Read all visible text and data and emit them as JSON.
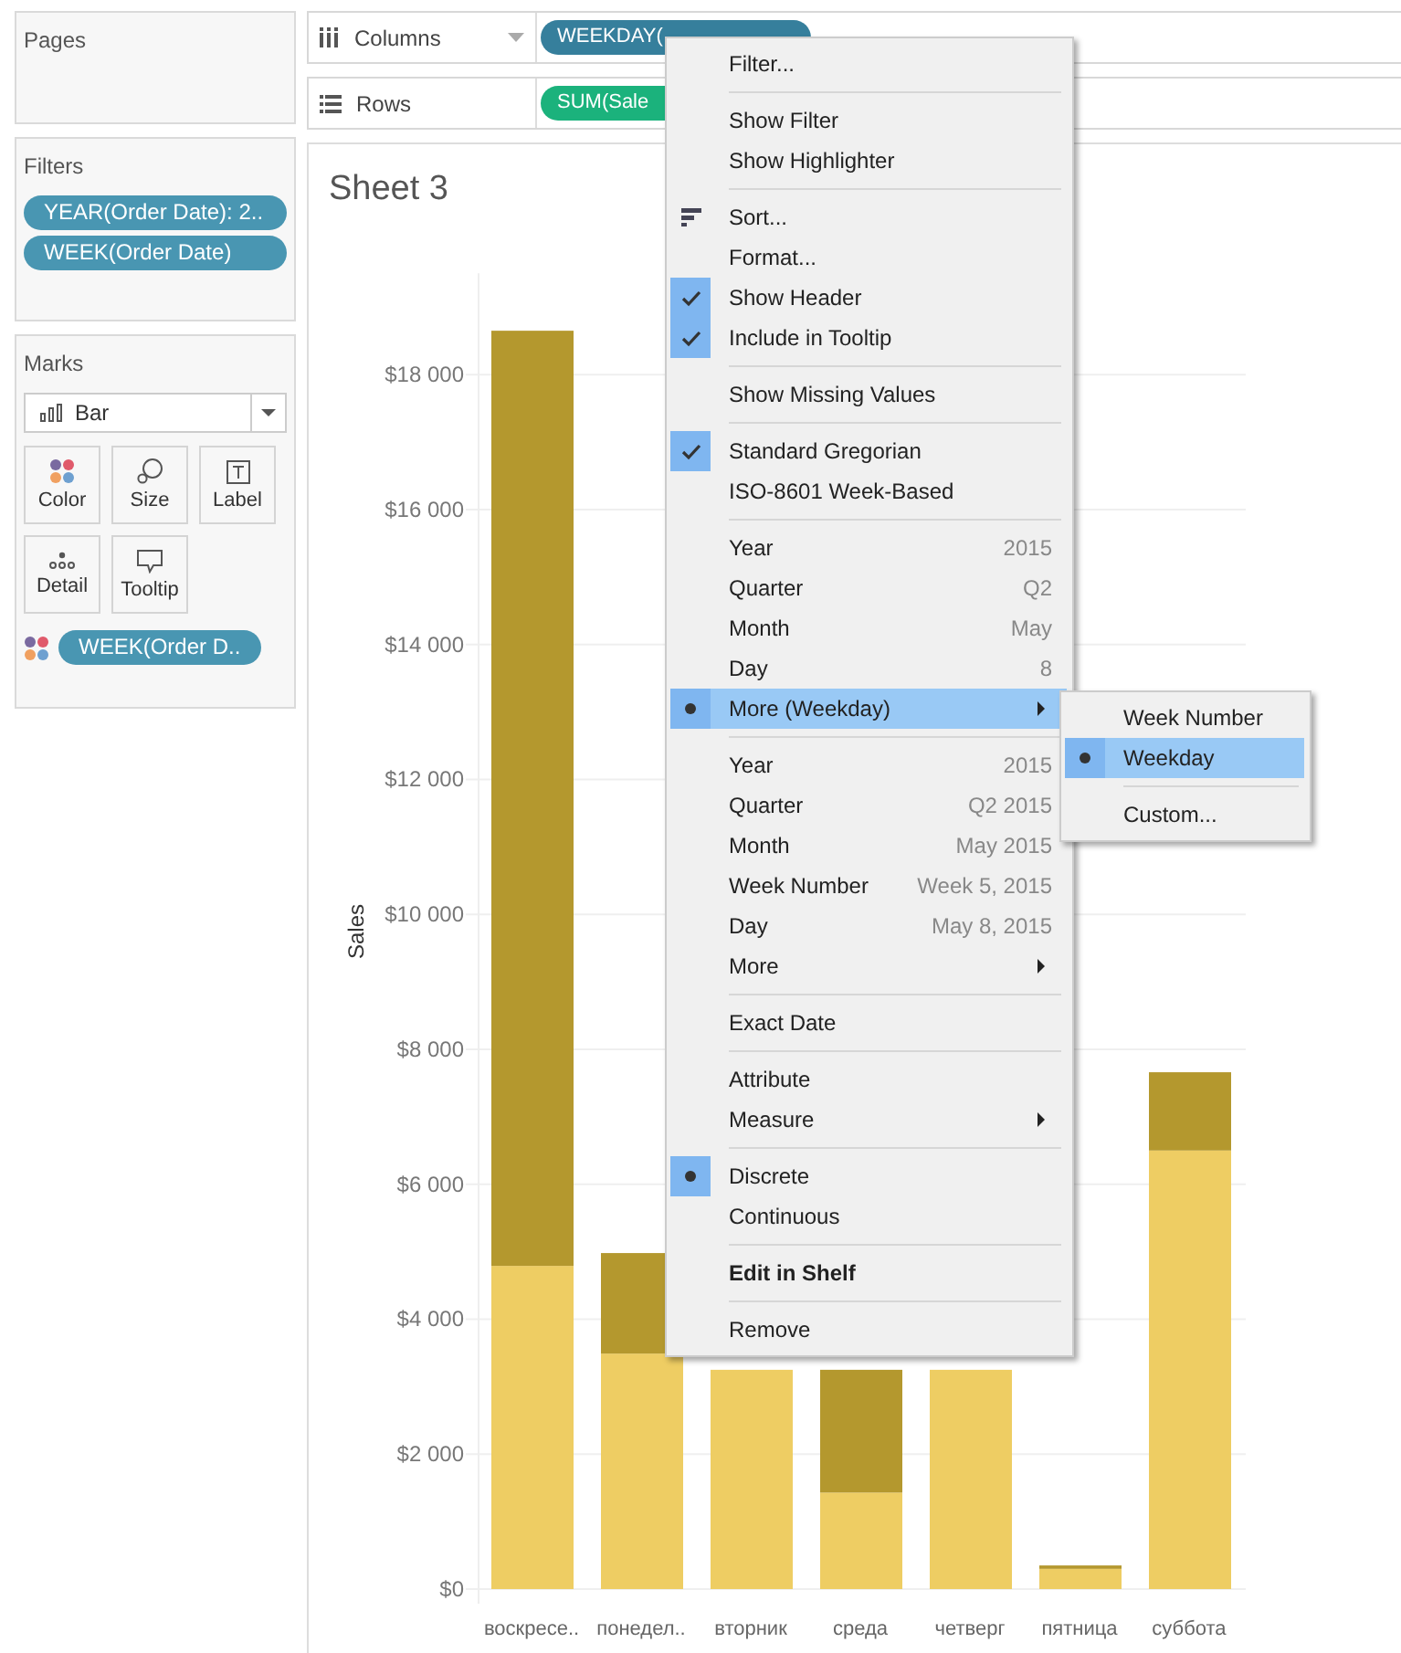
{
  "pages": {
    "title": "Pages"
  },
  "filters": {
    "title": "Filters",
    "pills": [
      "YEAR(Order Date): 2..",
      "WEEK(Order Date)"
    ]
  },
  "marks": {
    "title": "Marks",
    "mark_type": "Bar",
    "buttons": [
      {
        "label": "Color",
        "kind": "color"
      },
      {
        "label": "Size",
        "kind": "size"
      },
      {
        "label": "Label",
        "kind": "label"
      },
      {
        "label": "Detail",
        "kind": "detail"
      },
      {
        "label": "Tooltip",
        "kind": "tooltip"
      }
    ],
    "pill": "WEEK(Order D.."
  },
  "shelves": [
    {
      "label": "Columns",
      "kind": "columns",
      "pill": "WEEKDAY(",
      "measure": false
    },
    {
      "label": "Rows",
      "kind": "rows",
      "pill": "SUM(Sale",
      "measure": true
    }
  ],
  "sheet": {
    "title": "Sheet 3",
    "chart_data": {
      "type": "bar",
      "stacked": true,
      "ylabel": "Sales",
      "categories": [
        "воскресе..",
        "понедел..",
        "вторник",
        "среда",
        "четверг",
        "пятница",
        "суббота"
      ],
      "series": [
        {
          "color": "#eecd63",
          "values": [
            4790,
            3490,
            3250,
            1430,
            3250,
            300,
            6500
          ]
        },
        {
          "color": "#b4982e",
          "values": [
            13860,
            1490,
            null,
            1820,
            null,
            50,
            1160
          ]
        }
      ],
      "grid": true,
      "ylim": [
        0,
        19500
      ],
      "yticks": [
        {
          "value": 0,
          "label": "$0"
        },
        {
          "value": 2000,
          "label": "$2 000"
        },
        {
          "value": 4000,
          "label": "$4 000"
        },
        {
          "value": 6000,
          "label": "$6 000"
        },
        {
          "value": 8000,
          "label": "$8 000"
        },
        {
          "value": 10000,
          "label": "$10 000"
        },
        {
          "value": 12000,
          "label": "$12 000"
        },
        {
          "value": 14000,
          "label": "$14 000"
        },
        {
          "value": 16000,
          "label": "$16 000"
        },
        {
          "value": 18000,
          "label": "$18 000"
        }
      ]
    }
  },
  "context_menu": {
    "groups": [
      [
        {
          "label": "Filter...",
          "kind": "command",
          "checked": false,
          "selected": false,
          "submenu": false
        }
      ],
      [
        {
          "label": "Show Filter",
          "kind": "command",
          "checked": false,
          "selected": false,
          "submenu": false
        },
        {
          "label": "Show Highlighter",
          "kind": "command",
          "checked": false,
          "selected": false,
          "submenu": false
        }
      ],
      [
        {
          "label": "Sort...",
          "kind": "sort",
          "checked": false,
          "selected": false,
          "submenu": false
        },
        {
          "label": "Format...",
          "kind": "command",
          "checked": false,
          "selected": false,
          "submenu": false
        },
        {
          "label": "Show Header",
          "kind": "check",
          "checked": true,
          "selected": false,
          "submenu": false
        },
        {
          "label": "Include in Tooltip",
          "kind": "check",
          "checked": true,
          "selected": false,
          "submenu": false
        }
      ],
      [
        {
          "label": "Show Missing Values",
          "kind": "check",
          "checked": false,
          "selected": false,
          "submenu": false
        }
      ],
      [
        {
          "label": "Standard Gregorian",
          "kind": "check",
          "checked": true,
          "selected": false,
          "submenu": false
        },
        {
          "label": "ISO-8601 Week-Based",
          "kind": "check",
          "checked": false,
          "selected": false,
          "submenu": false
        }
      ],
      [
        {
          "label": "Year",
          "value": "2015",
          "kind": "radio",
          "checked": false,
          "selected": false,
          "submenu": false
        },
        {
          "label": "Quarter",
          "value": "Q2",
          "kind": "radio",
          "checked": false,
          "selected": false,
          "submenu": false
        },
        {
          "label": "Month",
          "value": "May",
          "kind": "radio",
          "checked": false,
          "selected": false,
          "submenu": false
        },
        {
          "label": "Day",
          "value": "8",
          "kind": "radio",
          "checked": false,
          "selected": false,
          "submenu": false
        },
        {
          "label": "More (Weekday)",
          "kind": "radio",
          "checked": true,
          "selected": true,
          "submenu": true
        }
      ],
      [
        {
          "label": "Year",
          "value": "2015",
          "kind": "radio",
          "checked": false,
          "selected": false,
          "submenu": false
        },
        {
          "label": "Quarter",
          "value": "Q2 2015",
          "kind": "radio",
          "checked": false,
          "selected": false,
          "submenu": false
        },
        {
          "label": "Month",
          "value": "May 2015",
          "kind": "radio",
          "checked": false,
          "selected": false,
          "submenu": false
        },
        {
          "label": "Week Number",
          "value": "Week 5, 2015",
          "kind": "radio",
          "checked": false,
          "selected": false,
          "submenu": false
        },
        {
          "label": "Day",
          "value": "May 8, 2015",
          "kind": "radio",
          "checked": false,
          "selected": false,
          "submenu": false
        },
        {
          "label": "More",
          "kind": "radio",
          "checked": false,
          "selected": false,
          "submenu": true
        }
      ],
      [
        {
          "label": "Exact Date",
          "kind": "radio",
          "checked": false,
          "selected": false,
          "submenu": false
        }
      ],
      [
        {
          "label": "Attribute",
          "kind": "radio",
          "checked": false,
          "selected": false,
          "submenu": false
        },
        {
          "label": "Measure",
          "kind": "radio",
          "checked": false,
          "selected": false,
          "submenu": true
        }
      ],
      [
        {
          "label": "Discrete",
          "kind": "radio",
          "checked": true,
          "selected": false,
          "submenu": false
        },
        {
          "label": "Continuous",
          "kind": "radio",
          "checked": false,
          "selected": false,
          "submenu": false
        }
      ],
      [
        {
          "label": "Edit in Shelf",
          "kind": "default",
          "checked": false,
          "selected": false,
          "submenu": false
        }
      ],
      [
        {
          "label": "Remove",
          "kind": "command",
          "checked": false,
          "selected": false,
          "submenu": false
        }
      ]
    ]
  },
  "submenu": {
    "groups": [
      [
        {
          "label": "Week Number",
          "kind": "radio",
          "checked": false,
          "selected": false
        },
        {
          "label": "Weekday",
          "kind": "radio",
          "checked": true,
          "selected": true
        }
      ],
      [
        {
          "label": "Custom...",
          "kind": "command",
          "checked": false,
          "selected": false
        }
      ]
    ]
  }
}
